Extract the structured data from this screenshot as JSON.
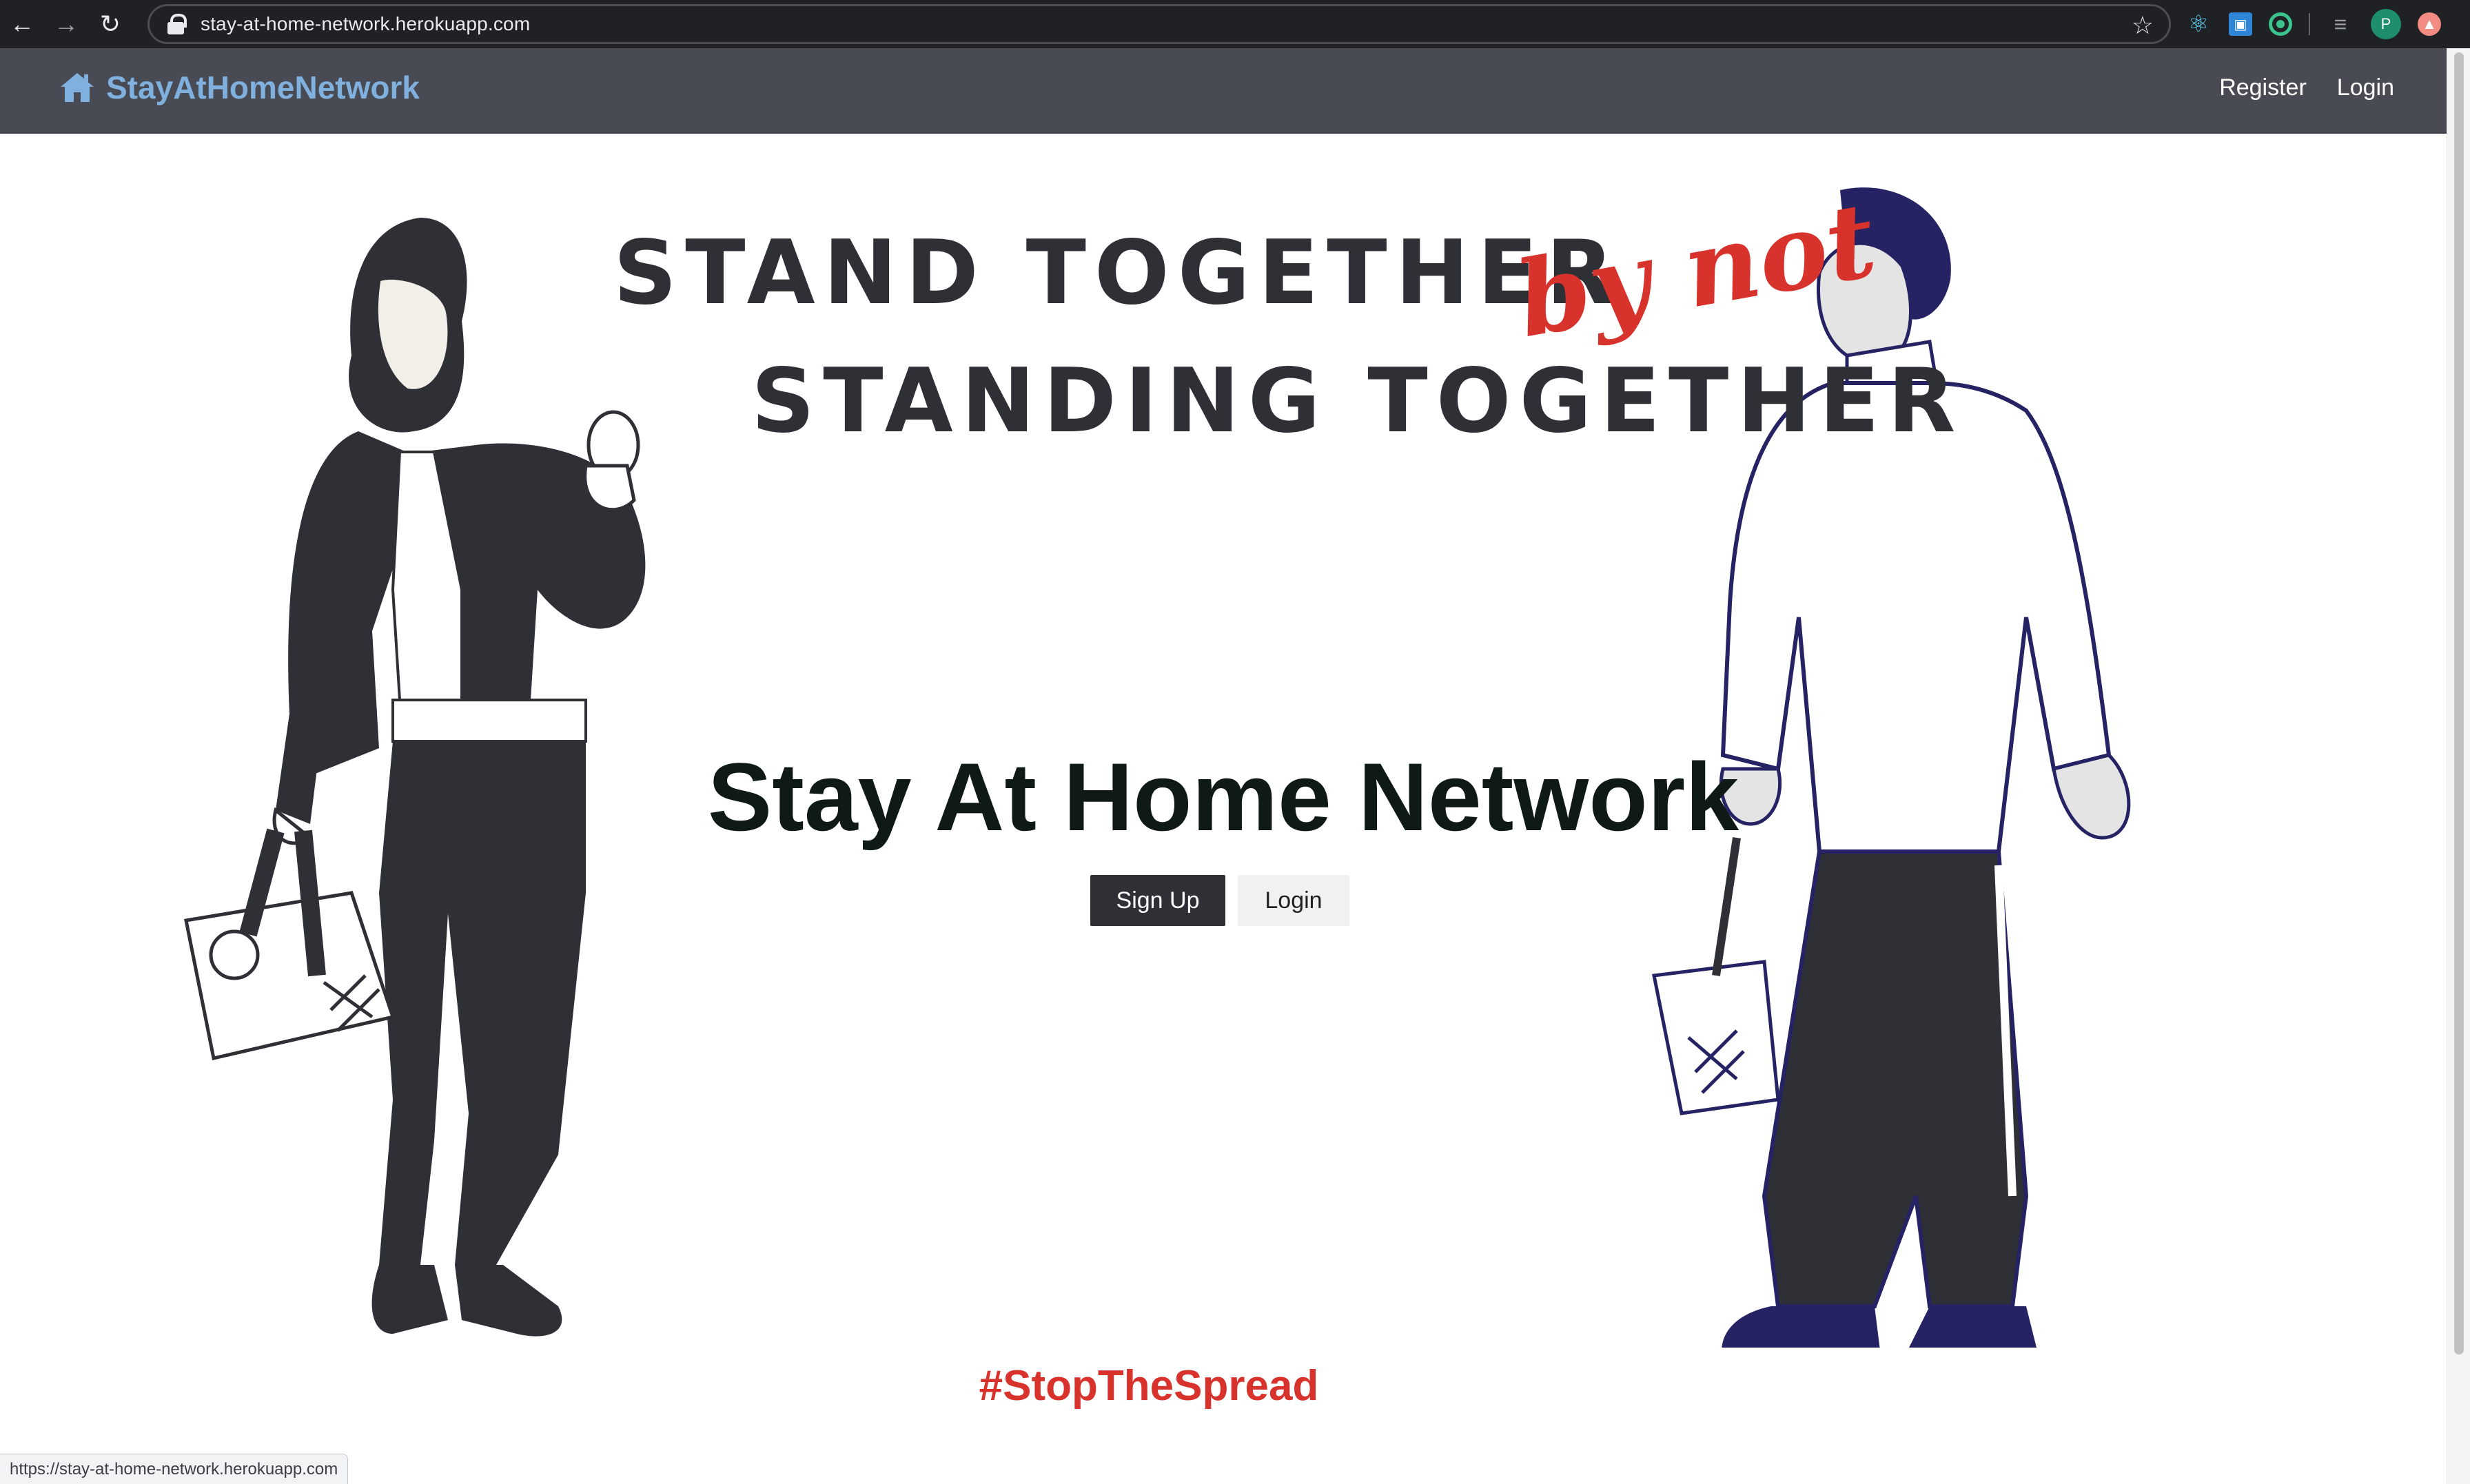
{
  "browser": {
    "url": "stay-at-home-network.herokuapp.com",
    "profile_initial": "P",
    "status_url": "https://stay-at-home-network.herokuapp.com"
  },
  "nav": {
    "brand": "StayAtHomeNetwork",
    "links": [
      "Register",
      "Login"
    ]
  },
  "hero": {
    "slogan_line1": "STAND TOGETHER",
    "slogan_script": "by not",
    "slogan_line2": "STANDING TOGETHER",
    "title": "Stay At Home Network",
    "signup_label": "Sign Up",
    "login_label": "Login",
    "hashtag": "#StopTheSpread"
  },
  "colors": {
    "navbar": "#484b54",
    "brand": "#7fb0de",
    "accent_red": "#d8322c",
    "dark_button": "#2f3036",
    "figure_dark": "#2f3035",
    "figure_navy": "#252363"
  },
  "icons": {
    "brand": "home-icon",
    "address_bar": "lock-icon",
    "bookmark": "star-icon"
  }
}
